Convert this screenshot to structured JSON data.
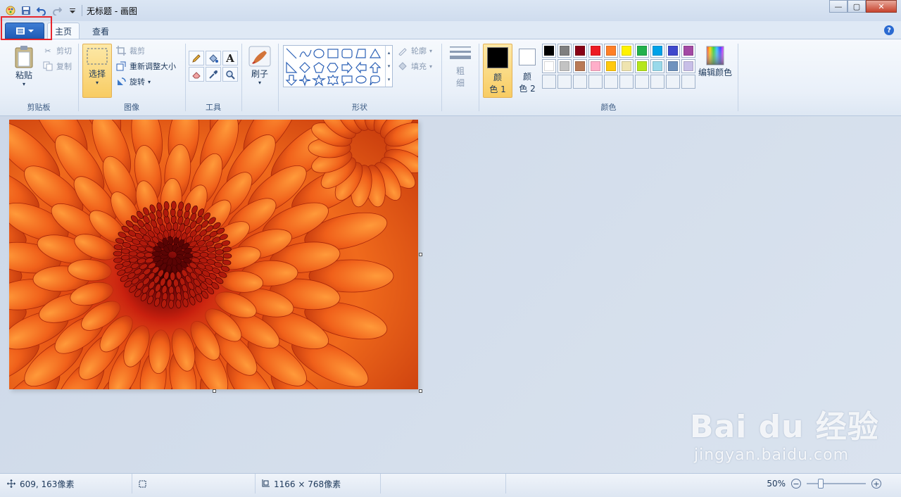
{
  "window": {
    "title": "无标题 - 画图"
  },
  "tabs": [
    {
      "label": "主页",
      "active": true
    },
    {
      "label": "查看",
      "active": false
    }
  ],
  "clipboard": {
    "paste": "粘贴",
    "cut": "剪切",
    "copy": "复制",
    "group": "剪贴板"
  },
  "image_group": {
    "select": "选择",
    "crop": "裁剪",
    "resize": "重新调整大小",
    "rotate": "旋转",
    "group": "图像"
  },
  "tools": {
    "group": "工具"
  },
  "brushes": {
    "label": "刷子"
  },
  "shapes": {
    "outline": "轮廓",
    "fill": "填充",
    "group": "形状"
  },
  "size": {
    "label_top": "粗",
    "label_bottom": "细"
  },
  "colors": {
    "color1_top": "颜",
    "color1_bottom": "色 1",
    "color2_top": "颜",
    "color2_bottom": "色 2",
    "edit": "编辑颜色",
    "group": "颜色",
    "palette_row1": [
      "#000000",
      "#7f7f7f",
      "#880015",
      "#ed1c24",
      "#ff7f27",
      "#fff200",
      "#22b14c",
      "#00a2e8",
      "#3f48cc",
      "#a349a4"
    ],
    "palette_row2": [
      "#ffffff",
      "#c3c3c3",
      "#b97a57",
      "#ffaec9",
      "#ffc90e",
      "#efe4b0",
      "#b5e61d",
      "#99d9ea",
      "#7092be",
      "#c8bfe7"
    ]
  },
  "status": {
    "cursor": "609, 163像素",
    "size": "1166 × 768像素",
    "zoom": "50%",
    "zoom_value_percent": 50
  },
  "watermark": {
    "line1": "Bai du 经验",
    "line2": "jingyan.baidu.com"
  }
}
